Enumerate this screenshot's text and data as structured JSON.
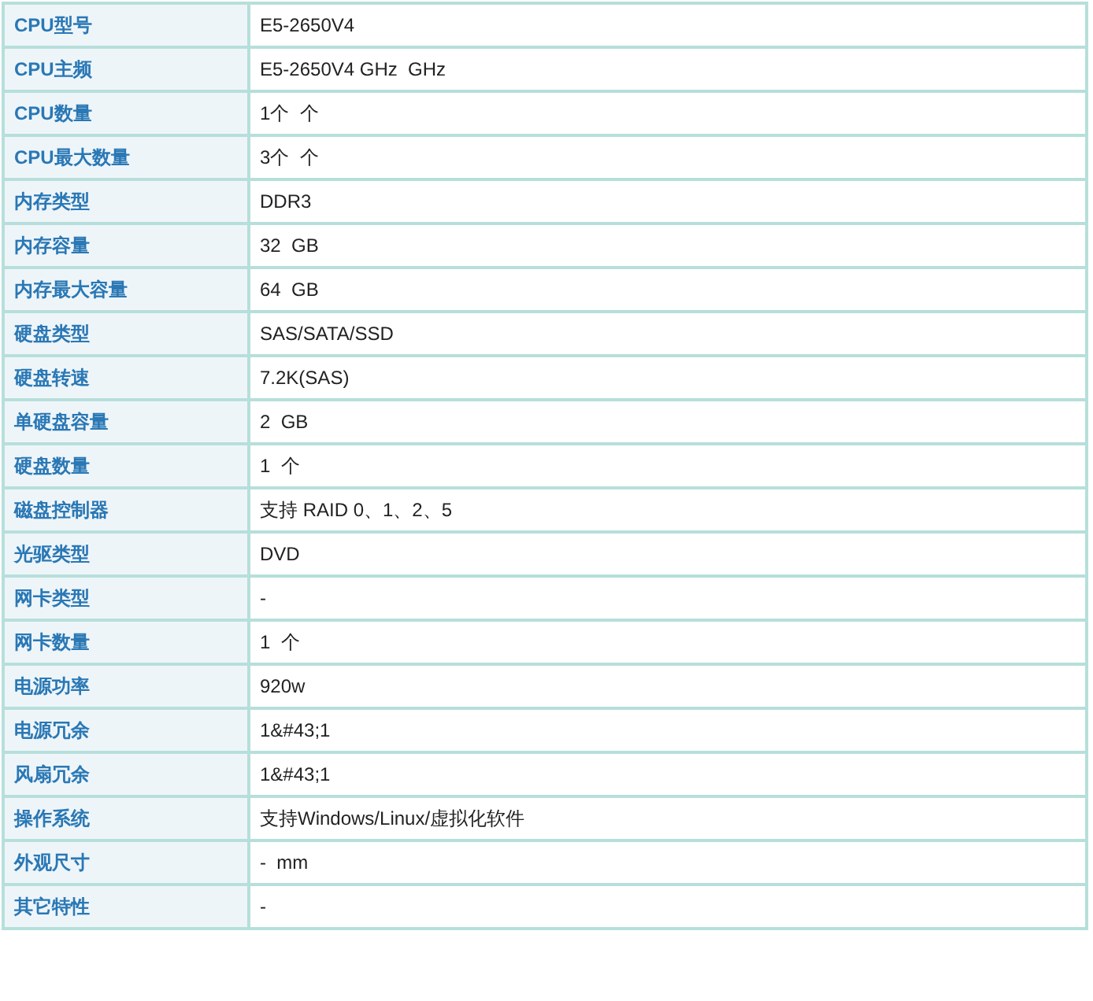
{
  "specs": [
    {
      "label": "CPU型号",
      "value": "E5-2650V4"
    },
    {
      "label": "CPU主频",
      "value": "E5-2650V4 GHz  GHz"
    },
    {
      "label": "CPU数量",
      "value": "1个  个"
    },
    {
      "label": "CPU最大数量",
      "value": "3个  个"
    },
    {
      "label": "内存类型",
      "value": "DDR3"
    },
    {
      "label": "内存容量",
      "value": "32  GB"
    },
    {
      "label": "内存最大容量",
      "value": "64  GB"
    },
    {
      "label": "硬盘类型",
      "value": "SAS/SATA/SSD"
    },
    {
      "label": "硬盘转速",
      "value": "7.2K(SAS)"
    },
    {
      "label": "单硬盘容量",
      "value": "2  GB"
    },
    {
      "label": "硬盘数量",
      "value": "1  个"
    },
    {
      "label": "磁盘控制器",
      "value": "支持 RAID 0、1、2、5"
    },
    {
      "label": "光驱类型",
      "value": "DVD"
    },
    {
      "label": "网卡类型",
      "value": "-"
    },
    {
      "label": "网卡数量",
      "value": "1  个"
    },
    {
      "label": "电源功率",
      "value": "920w"
    },
    {
      "label": "电源冗余",
      "value": "1&#43;1"
    },
    {
      "label": "风扇冗余",
      "value": "1&#43;1"
    },
    {
      "label": "操作系统",
      "value": "支持Windows/Linux/虚拟化软件"
    },
    {
      "label": "外观尺寸",
      "value": "-  mm"
    },
    {
      "label": "其它特性",
      "value": "-"
    }
  ]
}
